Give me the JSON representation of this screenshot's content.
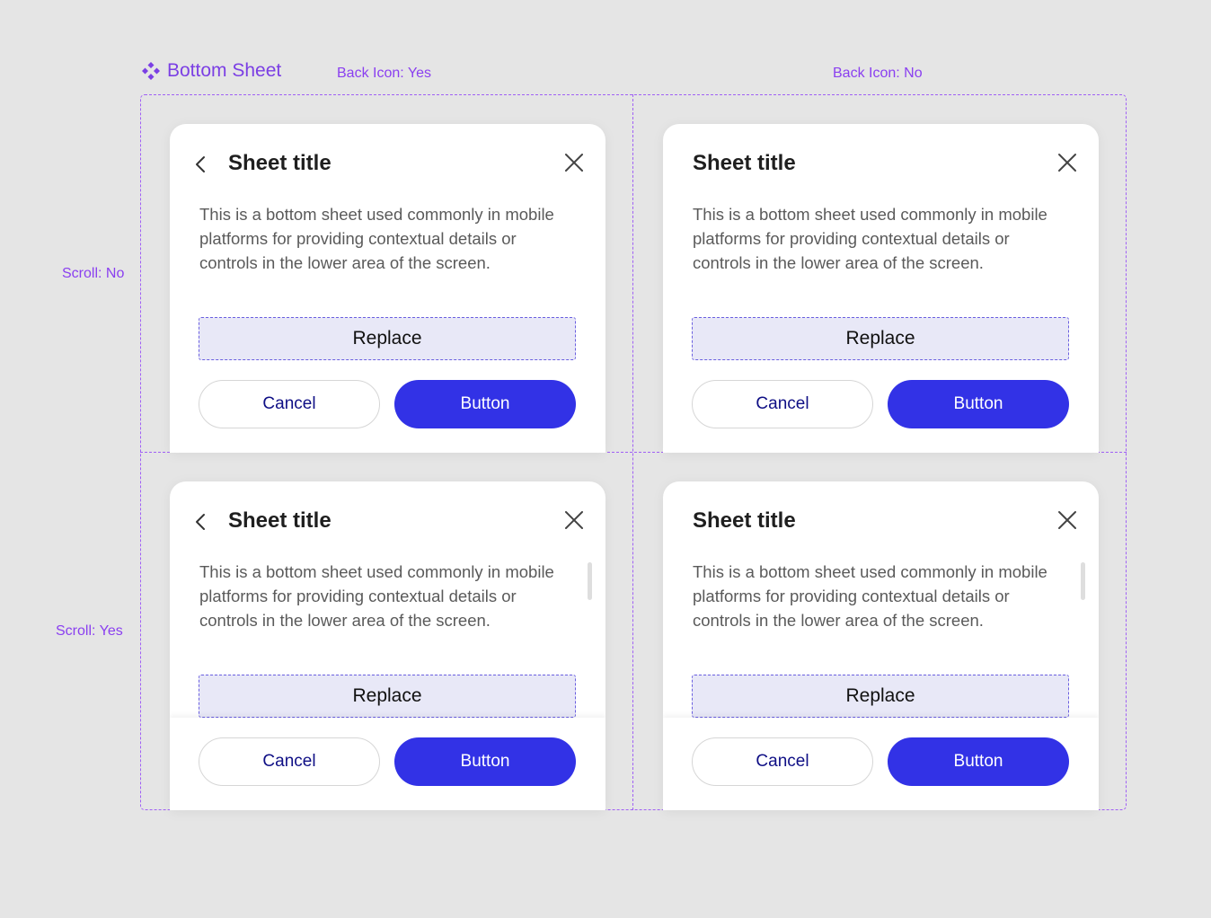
{
  "frame": {
    "title": "Bottom Sheet",
    "icon": "component-diamond-icon",
    "accent_color": "#7b3fe4"
  },
  "properties": {
    "col1": "Back Icon: Yes",
    "col2": "Back Icon: No",
    "row1": "Scroll: No",
    "row2": "Scroll: Yes"
  },
  "sheets": [
    {
      "title": "Sheet title",
      "body": "This is a bottom sheet used commonly in mobile platforms for providing contextual details or controls in the lower area of the screen.",
      "slot_label": "Replace",
      "cancel_label": "Cancel",
      "primary_label": "Button"
    },
    {
      "title": "Sheet title",
      "body": "This is a bottom sheet used commonly in mobile platforms for providing contextual details or controls in the lower area of the screen.",
      "slot_label": "Replace",
      "cancel_label": "Cancel",
      "primary_label": "Button"
    },
    {
      "title": "Sheet title",
      "body": "This is a bottom sheet used commonly in mobile platforms for providing contextual details or controls in the lower area of the screen.",
      "slot_label": "Replace",
      "cancel_label": "Cancel",
      "primary_label": "Button"
    },
    {
      "title": "Sheet title",
      "body": "This is a bottom sheet used commonly in mobile platforms for providing contextual details or controls in the lower area of the screen.",
      "slot_label": "Replace",
      "cancel_label": "Cancel",
      "primary_label": "Button"
    }
  ],
  "colors": {
    "primary_button": "#3232e6",
    "cancel_text": "#0f0f85",
    "dashed_outline": "#a060f5",
    "slot_fill": "#e8e8f7"
  }
}
